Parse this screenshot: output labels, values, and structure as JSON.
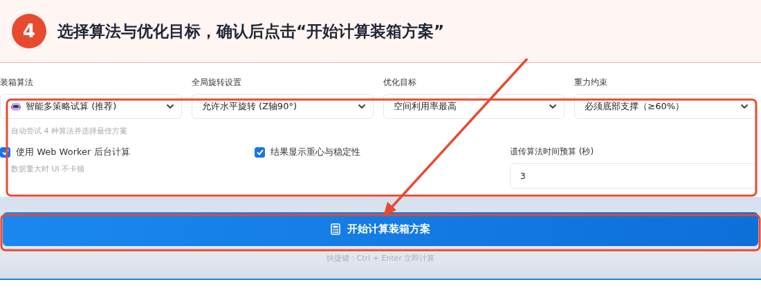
{
  "step": {
    "number": "4",
    "title": "选择算法与优化目标，确认后点击“开始计算装箱方案”"
  },
  "selects": [
    {
      "label": "装箱算法",
      "value": "智能多策略试算 (推荐)",
      "icon": true
    },
    {
      "label": "全局旋转设置",
      "value": "允许水平旋转 (Z轴90°)",
      "icon": false
    },
    {
      "label": "优化目标",
      "value": "空间利用率最高",
      "icon": false
    },
    {
      "label": "重力约束",
      "value": "必须底部支撑（≥60%）",
      "icon": false
    }
  ],
  "algorithm_hint": "自动尝试 4 种算法并选择最佳方案",
  "options": [
    {
      "label": "使用 Web Worker 后台计算",
      "checked": true,
      "hint": "数据量大时 UI 不卡顿"
    },
    {
      "label": "结果显示重心与稳定性",
      "checked": true
    }
  ],
  "time_budget": {
    "label": "遗传算法时间预算 (秒)",
    "value": "3"
  },
  "start_button": "开始计算装箱方案",
  "shortcut_hint": "快捷键：Ctrl + Enter 立即计算"
}
